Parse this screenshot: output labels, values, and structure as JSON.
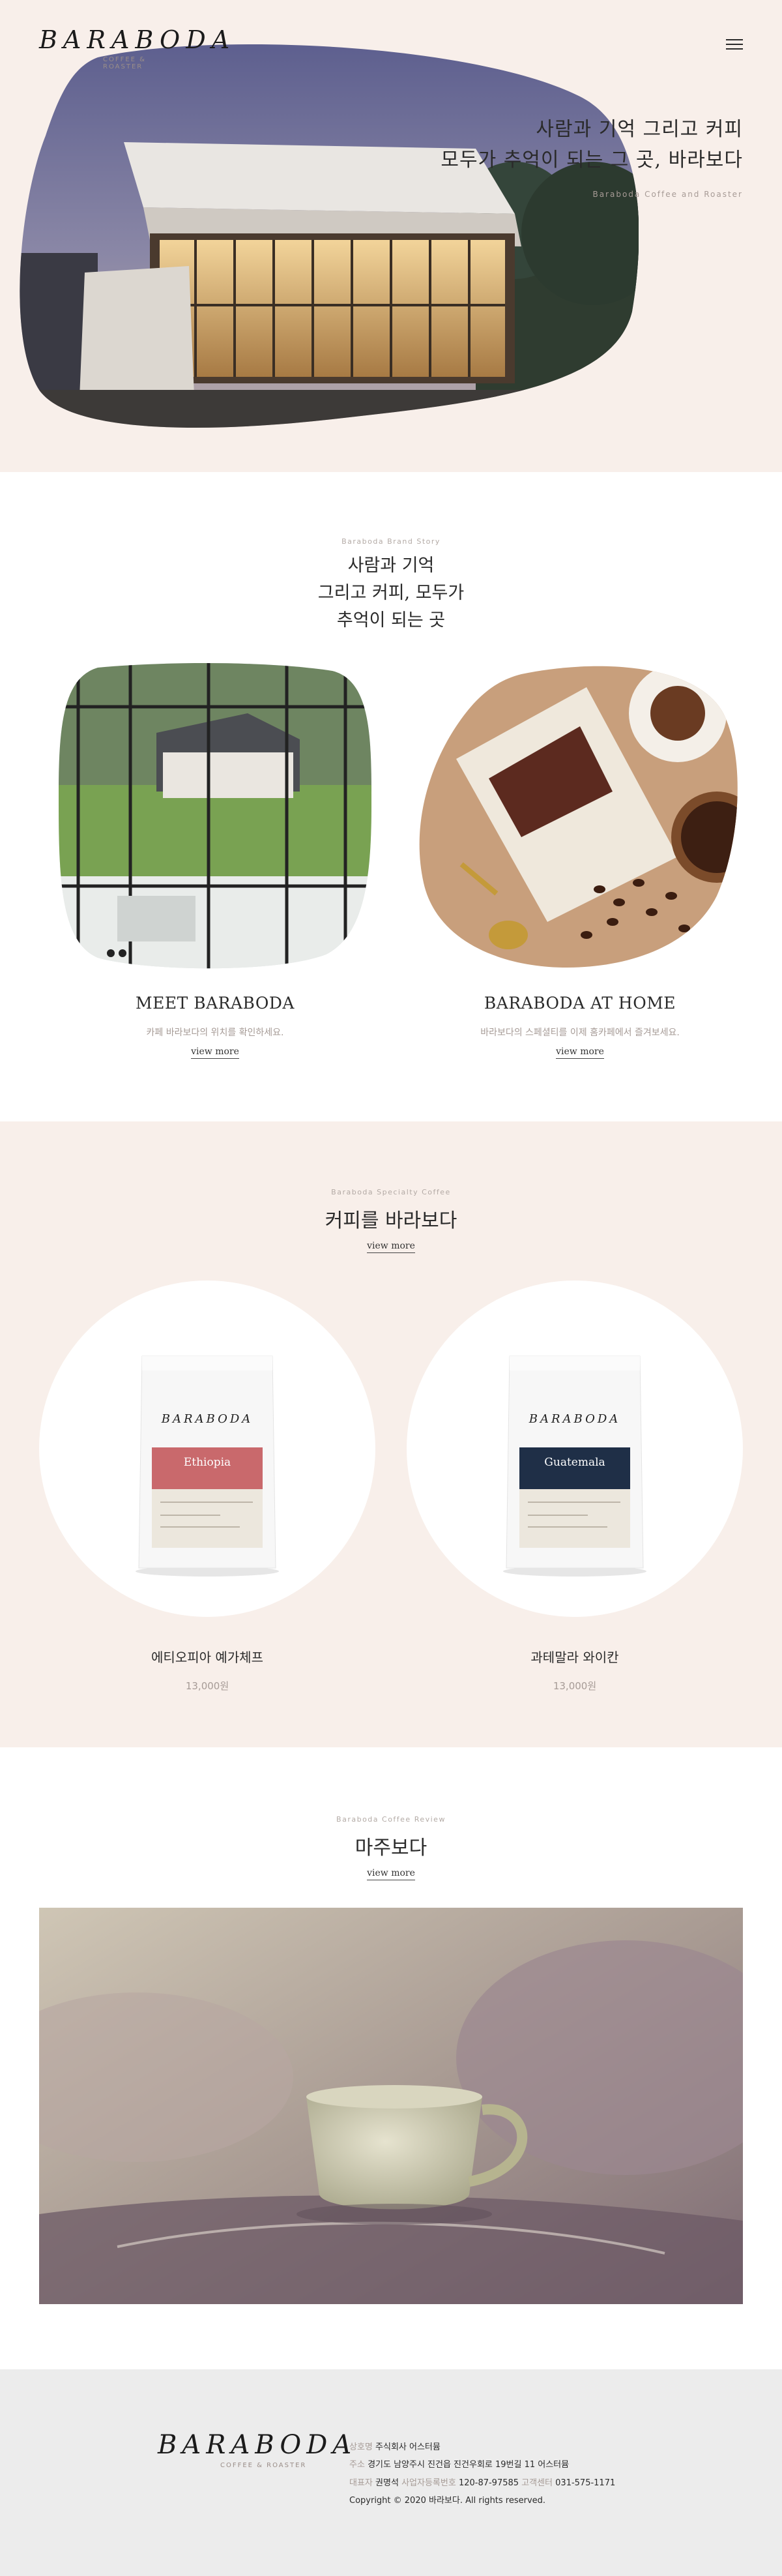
{
  "brand": {
    "name": "BARABODA",
    "tagline": "COFFEE & ROASTER"
  },
  "hero": {
    "line1": "사람과 기억 그리고 커피",
    "line2": "모두가 추억이 되는 그 곳, 바라보다",
    "sub": "Baraboda Coffee and Roaster"
  },
  "story": {
    "eyebrow": "Baraboda Brand Story",
    "title_lines": [
      "사람과 기억",
      "그리고 커피, 모두가",
      "추억이 되는 곳"
    ],
    "cards": [
      {
        "title": "MEET BARABODA",
        "desc": "카페 바라보다의 위치를 확인하세요.",
        "link": "view more"
      },
      {
        "title": "BARABODA AT HOME",
        "desc": "바라보다의 스페셜티를 이제 홈카페에서 즐겨보세요.",
        "link": "view more"
      }
    ]
  },
  "coffee": {
    "eyebrow": "Baraboda Specialty Coffee",
    "title": "커피를 바라보다",
    "link": "view more",
    "products": [
      {
        "name": "에티오피아 예가체프",
        "price": "13,000원",
        "label": "Ethiopia",
        "label_color": "#c9696c"
      },
      {
        "name": "과테말라 와이칸",
        "price": "13,000원",
        "label": "Guatemala",
        "label_color": "#1f2f47"
      }
    ]
  },
  "review": {
    "eyebrow": "Baraboda Coffee Review",
    "title": "마주보다",
    "link": "view more"
  },
  "footer": {
    "rows": [
      [
        {
          "k": "상호명",
          "v": "주식회사 어스터뮴"
        }
      ],
      [
        {
          "k": "주소",
          "v": "경기도 남양주시 진건읍 진건우회로 19번길 11 어스터뮴"
        }
      ],
      [
        {
          "k": "대표자",
          "v": "권명석"
        },
        {
          "k": "사업자등록번호",
          "v": "120-87-97585"
        },
        {
          "k": "고객센터",
          "v": "031-575-1171"
        }
      ],
      [
        {
          "k": "",
          "v": "Copyright © 2020 바라보다. All rights reserved."
        }
      ]
    ]
  },
  "colors": {
    "blush": "#f8efea",
    "footer": "#ececec",
    "muted": "#a69b96"
  }
}
